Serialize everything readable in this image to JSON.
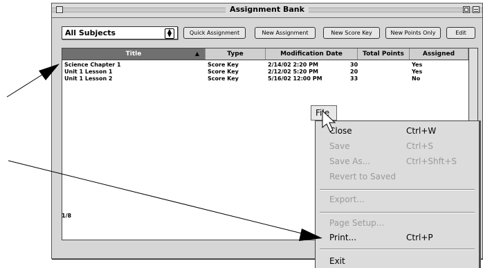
{
  "window": {
    "title": "Assignment Bank"
  },
  "toolbar": {
    "subject": "All Subjects",
    "buttons": [
      "Quick Assignment",
      "New Assignment",
      "New Score Key",
      "New Points Only",
      "Edit"
    ]
  },
  "table": {
    "columns": [
      "Title",
      "Type",
      "Modification Date",
      "Total Points",
      "Assigned"
    ],
    "rows": [
      [
        "Science Chapter 1",
        "Score Key",
        "2/14/02 2:20 PM",
        "30",
        "Yes"
      ],
      [
        "Unit 1 Lesson 1",
        "Score Key",
        "2/12/02 5:20 PM",
        "20",
        "Yes"
      ],
      [
        "Unit 1 Lesson 2",
        "Score Key",
        "5/16/02 12:00 PM",
        "33",
        "No"
      ]
    ]
  },
  "status": {
    "count": "1/8"
  },
  "menu": {
    "title": "File",
    "items": [
      {
        "label": "Close",
        "shortcut": "Ctrl+W",
        "enabled": true
      },
      {
        "label": "Save",
        "shortcut": "Ctrl+S",
        "enabled": false
      },
      {
        "label": "Save As...",
        "shortcut": "Ctrl+Shft+S",
        "enabled": false
      },
      {
        "label": "Revert to Saved",
        "shortcut": "",
        "enabled": false
      },
      {
        "label": "Export...",
        "shortcut": "",
        "enabled": false
      },
      {
        "label": "Page Setup...",
        "shortcut": "",
        "enabled": false
      },
      {
        "label": "Print...",
        "shortcut": "Ctrl+P",
        "enabled": true
      },
      {
        "label": "Exit",
        "shortcut": "",
        "enabled": true
      }
    ]
  },
  "icons": {
    "cursor": "arrow-pointer-icon",
    "annotation": "callout-arrow-icon",
    "sort": "sort-ascending-icon",
    "select": "select-arrows-icon"
  },
  "colors": {
    "window_bg": "#d6d6d6",
    "header_bg": "#cfcfcf",
    "sorted_header_bg": "#707070",
    "menu_bg": "#dcdcdc",
    "disabled_text": "#9a9a9a"
  }
}
